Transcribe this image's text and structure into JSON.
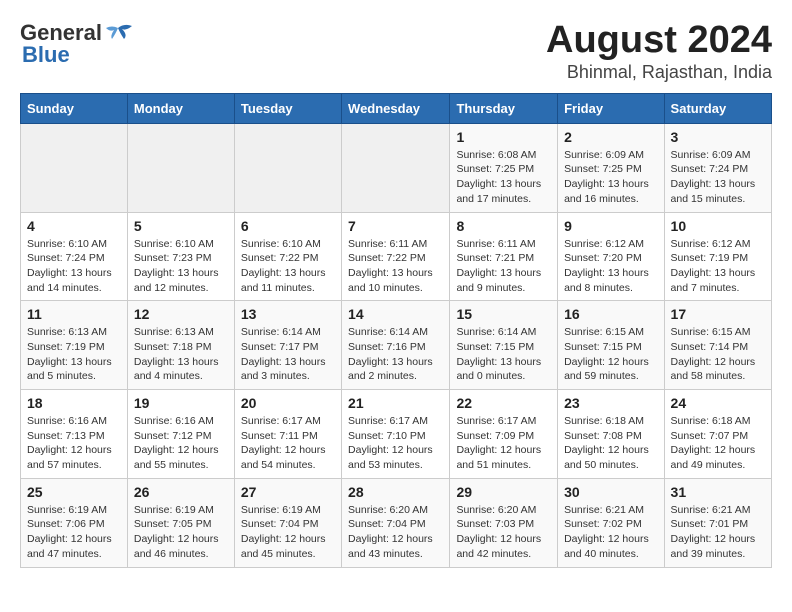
{
  "header": {
    "logo_general": "General",
    "logo_blue": "Blue",
    "title": "August 2024",
    "subtitle": "Bhinmal, Rajasthan, India"
  },
  "days_of_week": [
    "Sunday",
    "Monday",
    "Tuesday",
    "Wednesday",
    "Thursday",
    "Friday",
    "Saturday"
  ],
  "weeks": [
    [
      {
        "day": "",
        "info": ""
      },
      {
        "day": "",
        "info": ""
      },
      {
        "day": "",
        "info": ""
      },
      {
        "day": "",
        "info": ""
      },
      {
        "day": "1",
        "info": "Sunrise: 6:08 AM\nSunset: 7:25 PM\nDaylight: 13 hours\nand 17 minutes."
      },
      {
        "day": "2",
        "info": "Sunrise: 6:09 AM\nSunset: 7:25 PM\nDaylight: 13 hours\nand 16 minutes."
      },
      {
        "day": "3",
        "info": "Sunrise: 6:09 AM\nSunset: 7:24 PM\nDaylight: 13 hours\nand 15 minutes."
      }
    ],
    [
      {
        "day": "4",
        "info": "Sunrise: 6:10 AM\nSunset: 7:24 PM\nDaylight: 13 hours\nand 14 minutes."
      },
      {
        "day": "5",
        "info": "Sunrise: 6:10 AM\nSunset: 7:23 PM\nDaylight: 13 hours\nand 12 minutes."
      },
      {
        "day": "6",
        "info": "Sunrise: 6:10 AM\nSunset: 7:22 PM\nDaylight: 13 hours\nand 11 minutes."
      },
      {
        "day": "7",
        "info": "Sunrise: 6:11 AM\nSunset: 7:22 PM\nDaylight: 13 hours\nand 10 minutes."
      },
      {
        "day": "8",
        "info": "Sunrise: 6:11 AM\nSunset: 7:21 PM\nDaylight: 13 hours\nand 9 minutes."
      },
      {
        "day": "9",
        "info": "Sunrise: 6:12 AM\nSunset: 7:20 PM\nDaylight: 13 hours\nand 8 minutes."
      },
      {
        "day": "10",
        "info": "Sunrise: 6:12 AM\nSunset: 7:19 PM\nDaylight: 13 hours\nand 7 minutes."
      }
    ],
    [
      {
        "day": "11",
        "info": "Sunrise: 6:13 AM\nSunset: 7:19 PM\nDaylight: 13 hours\nand 5 minutes."
      },
      {
        "day": "12",
        "info": "Sunrise: 6:13 AM\nSunset: 7:18 PM\nDaylight: 13 hours\nand 4 minutes."
      },
      {
        "day": "13",
        "info": "Sunrise: 6:14 AM\nSunset: 7:17 PM\nDaylight: 13 hours\nand 3 minutes."
      },
      {
        "day": "14",
        "info": "Sunrise: 6:14 AM\nSunset: 7:16 PM\nDaylight: 13 hours\nand 2 minutes."
      },
      {
        "day": "15",
        "info": "Sunrise: 6:14 AM\nSunset: 7:15 PM\nDaylight: 13 hours\nand 0 minutes."
      },
      {
        "day": "16",
        "info": "Sunrise: 6:15 AM\nSunset: 7:15 PM\nDaylight: 12 hours\nand 59 minutes."
      },
      {
        "day": "17",
        "info": "Sunrise: 6:15 AM\nSunset: 7:14 PM\nDaylight: 12 hours\nand 58 minutes."
      }
    ],
    [
      {
        "day": "18",
        "info": "Sunrise: 6:16 AM\nSunset: 7:13 PM\nDaylight: 12 hours\nand 57 minutes."
      },
      {
        "day": "19",
        "info": "Sunrise: 6:16 AM\nSunset: 7:12 PM\nDaylight: 12 hours\nand 55 minutes."
      },
      {
        "day": "20",
        "info": "Sunrise: 6:17 AM\nSunset: 7:11 PM\nDaylight: 12 hours\nand 54 minutes."
      },
      {
        "day": "21",
        "info": "Sunrise: 6:17 AM\nSunset: 7:10 PM\nDaylight: 12 hours\nand 53 minutes."
      },
      {
        "day": "22",
        "info": "Sunrise: 6:17 AM\nSunset: 7:09 PM\nDaylight: 12 hours\nand 51 minutes."
      },
      {
        "day": "23",
        "info": "Sunrise: 6:18 AM\nSunset: 7:08 PM\nDaylight: 12 hours\nand 50 minutes."
      },
      {
        "day": "24",
        "info": "Sunrise: 6:18 AM\nSunset: 7:07 PM\nDaylight: 12 hours\nand 49 minutes."
      }
    ],
    [
      {
        "day": "25",
        "info": "Sunrise: 6:19 AM\nSunset: 7:06 PM\nDaylight: 12 hours\nand 47 minutes."
      },
      {
        "day": "26",
        "info": "Sunrise: 6:19 AM\nSunset: 7:05 PM\nDaylight: 12 hours\nand 46 minutes."
      },
      {
        "day": "27",
        "info": "Sunrise: 6:19 AM\nSunset: 7:04 PM\nDaylight: 12 hours\nand 45 minutes."
      },
      {
        "day": "28",
        "info": "Sunrise: 6:20 AM\nSunset: 7:04 PM\nDaylight: 12 hours\nand 43 minutes."
      },
      {
        "day": "29",
        "info": "Sunrise: 6:20 AM\nSunset: 7:03 PM\nDaylight: 12 hours\nand 42 minutes."
      },
      {
        "day": "30",
        "info": "Sunrise: 6:21 AM\nSunset: 7:02 PM\nDaylight: 12 hours\nand 40 minutes."
      },
      {
        "day": "31",
        "info": "Sunrise: 6:21 AM\nSunset: 7:01 PM\nDaylight: 12 hours\nand 39 minutes."
      }
    ]
  ]
}
